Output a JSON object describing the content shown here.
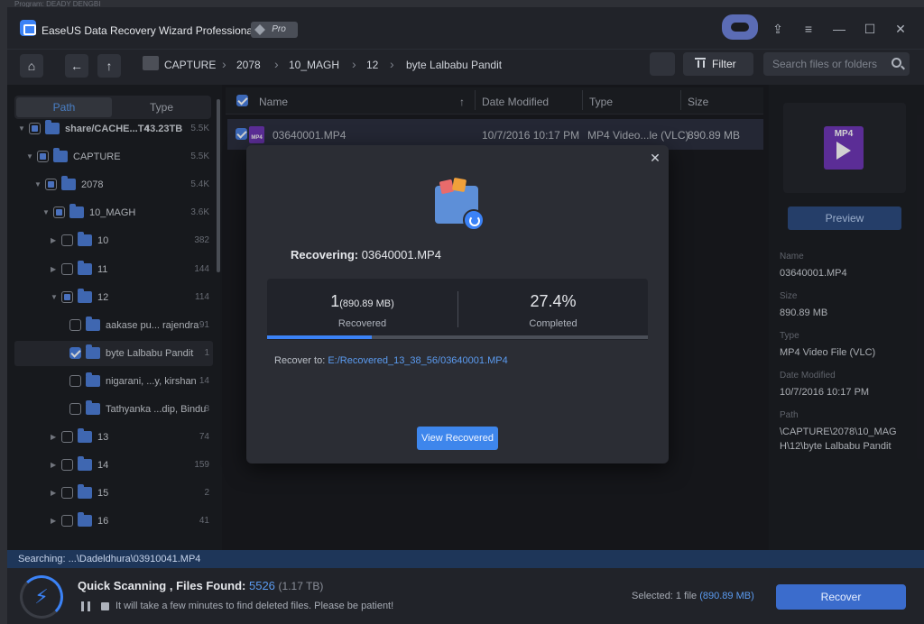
{
  "app": {
    "title": "EaseUS Data Recovery Wizard Professional",
    "badge": "Pro",
    "behind_window_text": "Program: DEADY DENGBI"
  },
  "window_controls": {
    "upload": "⇪",
    "menu": "≡",
    "minimize": "—",
    "maximize": "☐",
    "close": "✕"
  },
  "toolbar": {
    "home": "⌂",
    "back": "←",
    "up": "↑",
    "breadcrumb": [
      "CAPTURE",
      "2078",
      "10_MAGH",
      "12",
      "byte Lalbabu Pandit"
    ],
    "separator": "›",
    "filter_label": "Filter",
    "search_placeholder": "Search files or folders"
  },
  "left_panel": {
    "tabs": [
      "Path",
      "Type"
    ],
    "tree": [
      {
        "label": "share/CACHE...T4",
        "extra": "43.23TB",
        "count": "5.5K",
        "depth": 0,
        "caret": "▼",
        "check": "partial",
        "bold": true
      },
      {
        "label": "CAPTURE",
        "count": "5.5K",
        "depth": 1,
        "caret": "▼",
        "check": "partial"
      },
      {
        "label": "2078",
        "count": "5.4K",
        "depth": 2,
        "caret": "▼",
        "check": "partial"
      },
      {
        "label": "10_MAGH",
        "count": "3.6K",
        "depth": 3,
        "caret": "▼",
        "check": "partial"
      },
      {
        "label": "10",
        "count": "382",
        "depth": 4,
        "caret": "▶",
        "check": "off"
      },
      {
        "label": "11",
        "count": "144",
        "depth": 4,
        "caret": "▶",
        "check": "off"
      },
      {
        "label": "12",
        "count": "114",
        "depth": 4,
        "caret": "▼",
        "check": "partial"
      },
      {
        "label": "aakase pu... rajendra",
        "count": "91",
        "depth": 5,
        "caret": "",
        "check": "off"
      },
      {
        "label": "byte Lalbabu Pandit",
        "count": "1",
        "depth": 5,
        "caret": "",
        "check": "on",
        "selected": true
      },
      {
        "label": "nigarani, ...y, kirshan",
        "count": "14",
        "depth": 5,
        "caret": "",
        "check": "off"
      },
      {
        "label": "Tathyanka ...dip, Bindu",
        "count": "8",
        "depth": 5,
        "caret": "",
        "check": "off"
      },
      {
        "label": "13",
        "count": "74",
        "depth": 4,
        "caret": "▶",
        "check": "off"
      },
      {
        "label": "14",
        "count": "159",
        "depth": 4,
        "caret": "▶",
        "check": "off"
      },
      {
        "label": "15",
        "count": "2",
        "depth": 4,
        "caret": "▶",
        "check": "off"
      },
      {
        "label": "16",
        "count": "41",
        "depth": 4,
        "caret": "▶",
        "check": "off"
      }
    ]
  },
  "file_list": {
    "columns": {
      "name": "Name",
      "sort": "↑",
      "modified": "Date Modified",
      "type": "Type",
      "size": "Size"
    },
    "rows": [
      {
        "icon": "MP4",
        "name": "03640001.MP4",
        "modified": "10/7/2016 10:17 PM",
        "type": "MP4 Video...le (VLC)",
        "size": "890.89 MB"
      }
    ]
  },
  "details": {
    "thumb_label": "MP4",
    "preview_label": "Preview",
    "fields": [
      {
        "label": "Name",
        "value": "03640001.MP4"
      },
      {
        "label": "Size",
        "value": "890.89 MB"
      },
      {
        "label": "Type",
        "value": "MP4 Video File (VLC)"
      },
      {
        "label": "Date Modified",
        "value": "10/7/2016 10:17 PM"
      },
      {
        "label": "Path",
        "value": "\\CAPTURE\\2078\\10_MAGH\\12\\byte Lalbabu Pandit"
      }
    ]
  },
  "modal": {
    "close": "✕",
    "recovering_prefix": "Recovering:",
    "recovering_file": "03640001.MP4",
    "recovered_count": "1",
    "recovered_size": "(890.89 MB)",
    "recovered_label": "Recovered",
    "percent": "27.4%",
    "percent_label": "Completed",
    "progress_fraction": 0.274,
    "recover_to_label": "Recover to:",
    "recover_to_path": "E:/Recovered_13_38_56/03640001.MP4",
    "view_button": "View Recovered"
  },
  "status": {
    "searching": "Searching: ...\\Dadeldhura\\03910041.MP4",
    "scan_title": "Quick Scanning , Files Found:",
    "scan_count": "5526",
    "scan_size": "(1.17 TB)",
    "scan_hint": "It will take a few minutes to find deleted files. Please be patient!",
    "bolt": "⚡",
    "selected_prefix": "Selected: 1 file",
    "selected_size": "(890.89 MB)",
    "recover_button": "Recover"
  },
  "colors": {
    "accent": "#3b82f6",
    "mp4": "#6f38b8",
    "folder": "#4d7ed8",
    "status_bar": "#1e3659"
  }
}
